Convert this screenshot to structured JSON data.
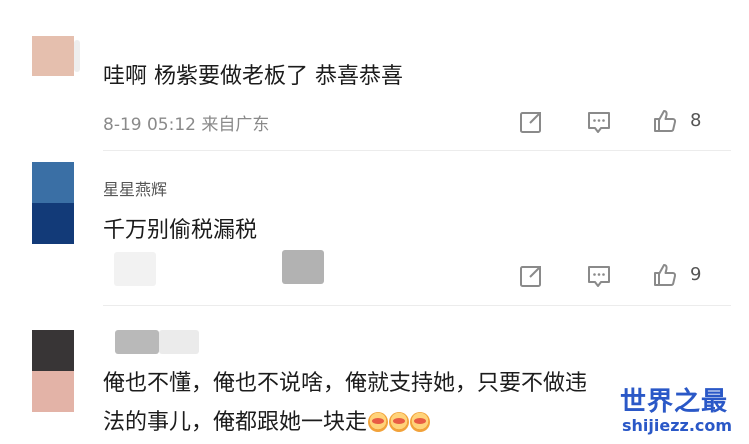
{
  "comments": [
    {
      "text": "哇啊 杨紫要做老板了 恭喜恭喜",
      "meta": "8-19 05:12 来自广东",
      "likes": "8"
    },
    {
      "name": "星星燕辉",
      "text": "千万别偷税漏税",
      "likes": "9"
    },
    {
      "text_line1": "俺也不懂，俺也不说啥，俺就支持她，只要不做违",
      "text_line2": "法的事儿，俺都跟她一块走"
    }
  ],
  "icons": {
    "share": "share-icon",
    "comment": "comment-icon",
    "like": "thumbs-up-icon",
    "emoji": "kissing-face-emoji"
  },
  "watermark": {
    "line1": "世界之最",
    "line2": "shijiezz.com"
  },
  "colors": {
    "icon": "#8a8a8a",
    "watermark": "#2a58c7"
  }
}
